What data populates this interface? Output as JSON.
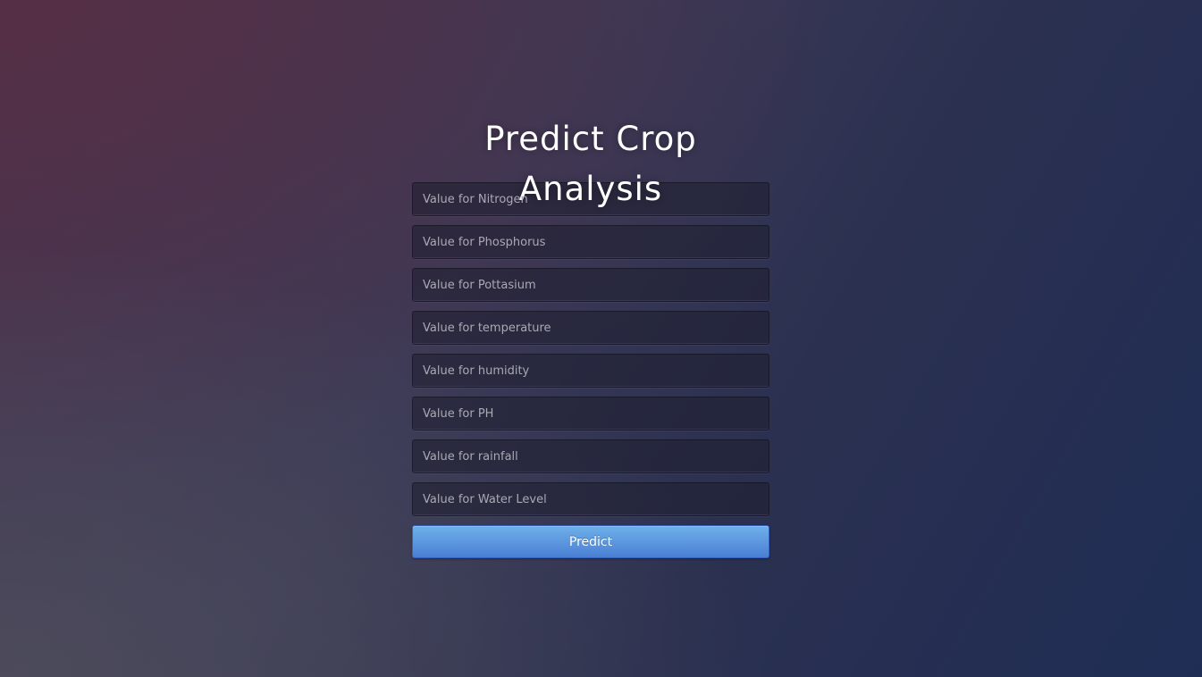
{
  "page": {
    "title": "Predict Crop Analysis"
  },
  "form": {
    "fields": [
      {
        "placeholder": "Value for Nitrogen",
        "value": ""
      },
      {
        "placeholder": "Value for Phosphorus",
        "value": ""
      },
      {
        "placeholder": "Value for Pottasium",
        "value": ""
      },
      {
        "placeholder": "Value for temperature",
        "value": ""
      },
      {
        "placeholder": "Value for humidity",
        "value": ""
      },
      {
        "placeholder": "Value for PH",
        "value": ""
      },
      {
        "placeholder": "Value for rainfall",
        "value": ""
      },
      {
        "placeholder": "Value for Water Level",
        "value": ""
      }
    ],
    "submit_label": "Predict"
  },
  "colors": {
    "background_start": "#4a3550",
    "background_end": "#1f2d55",
    "button_top": "#6eb0ea",
    "button_bottom": "#4a7fd4",
    "title": "#ffffff"
  }
}
